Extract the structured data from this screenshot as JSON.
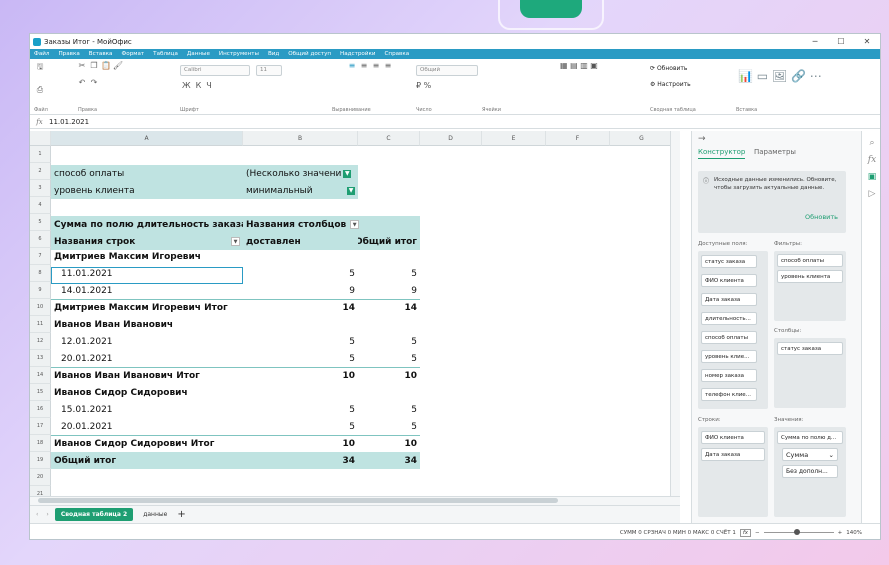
{
  "window": {
    "title": "Заказы Итог - МойОфис",
    "controls": [
      "─",
      "☐",
      "✕"
    ]
  },
  "menu": [
    "Файл",
    "Правка",
    "Вставка",
    "Формат",
    "Таблица",
    "Данные",
    "Инструменты",
    "Вид",
    "Общий доступ",
    "Надстройки",
    "Справка"
  ],
  "ribbon": {
    "groups": [
      "Файл",
      "Правка",
      "Шрифт",
      "Выравнивание",
      "Число",
      "Ячейки",
      "Сводная таблица",
      "Вставка"
    ],
    "font": "Calibri",
    "size": "11",
    "number_format": "Общий",
    "refresh": "Обновить",
    "configure": "Настроить"
  },
  "formula": {
    "value": "11.01.2021"
  },
  "columns": [
    "A",
    "B",
    "C",
    "D",
    "E",
    "F",
    "G"
  ],
  "rows": [
    "1",
    "2",
    "3",
    "4",
    "5",
    "6",
    "7",
    "8",
    "9",
    "10",
    "11",
    "12",
    "13",
    "14",
    "15",
    "16",
    "17",
    "18",
    "19",
    "20",
    "21"
  ],
  "cells": {
    "r2a": "способ оплаты",
    "r2b": "(Несколько значени",
    "r3a": "уровень клиента",
    "r3b": "минимальный",
    "r5a": "Сумма по полю длительность заказа",
    "r5b": "Названия столбцов",
    "r6a": "Названия строк",
    "r6b": "доставлен",
    "r6c": "Общий итог",
    "r7a": "Дмитриев Максим Игоревич",
    "r8a": "11.01.2021",
    "r8b": "5",
    "r8c": "5",
    "r9a": "14.01.2021",
    "r9b": "9",
    "r9c": "9",
    "r10a": "Дмитриев Максим Игоревич Итог",
    "r10b": "14",
    "r10c": "14",
    "r11a": "Иванов Иван Иванович",
    "r12a": "12.01.2021",
    "r12b": "5",
    "r12c": "5",
    "r13a": "20.01.2021",
    "r13b": "5",
    "r13c": "5",
    "r14a": "Иванов Иван Иванович Итог",
    "r14b": "10",
    "r14c": "10",
    "r15a": "Иванов Сидор Сидорович",
    "r16a": "15.01.2021",
    "r16b": "5",
    "r16c": "5",
    "r17a": "20.01.2021",
    "r17b": "5",
    "r17c": "5",
    "r18a": "Иванов Сидор Сидорович Итог",
    "r18b": "10",
    "r18c": "10",
    "r19a": "Общий итог",
    "r19b": "34",
    "r19c": "34"
  },
  "tabs": {
    "active": "Сводная таблица 2",
    "other": "данные",
    "add": "+"
  },
  "status": {
    "text": "СУММ 0  СРЗНАЧ 0  МИН 0  МАКС 0  СЧЁТ 1",
    "zoom": "140%"
  },
  "panel": {
    "tab_constructor": "Конструктор",
    "tab_params": "Параметры",
    "notice": "Исходные данные изменились. Обновите, чтобы загрузить актуальные данные.",
    "refresh": "Обновить",
    "available_label": "Доступные поля:",
    "filters_label": "Фильтры:",
    "columns_label": "Столбцы:",
    "rows_label": "Строки:",
    "values_label": "Значения:",
    "available": [
      "статус заказа",
      "ФИО клиента",
      "Дата заказа",
      "длительность...",
      "способ оплаты",
      "уровень клие...",
      "номер заказа",
      "телефон клие..."
    ],
    "filters": [
      "способ оплаты",
      "уровень клиента"
    ],
    "columns": [
      "статус заказа"
    ],
    "rows": [
      "ФИО клиента",
      "Дата заказа"
    ],
    "values": [
      "Сумма по полю д..."
    ],
    "value_func": "Сумма",
    "value_extra": "Без дополн..."
  }
}
